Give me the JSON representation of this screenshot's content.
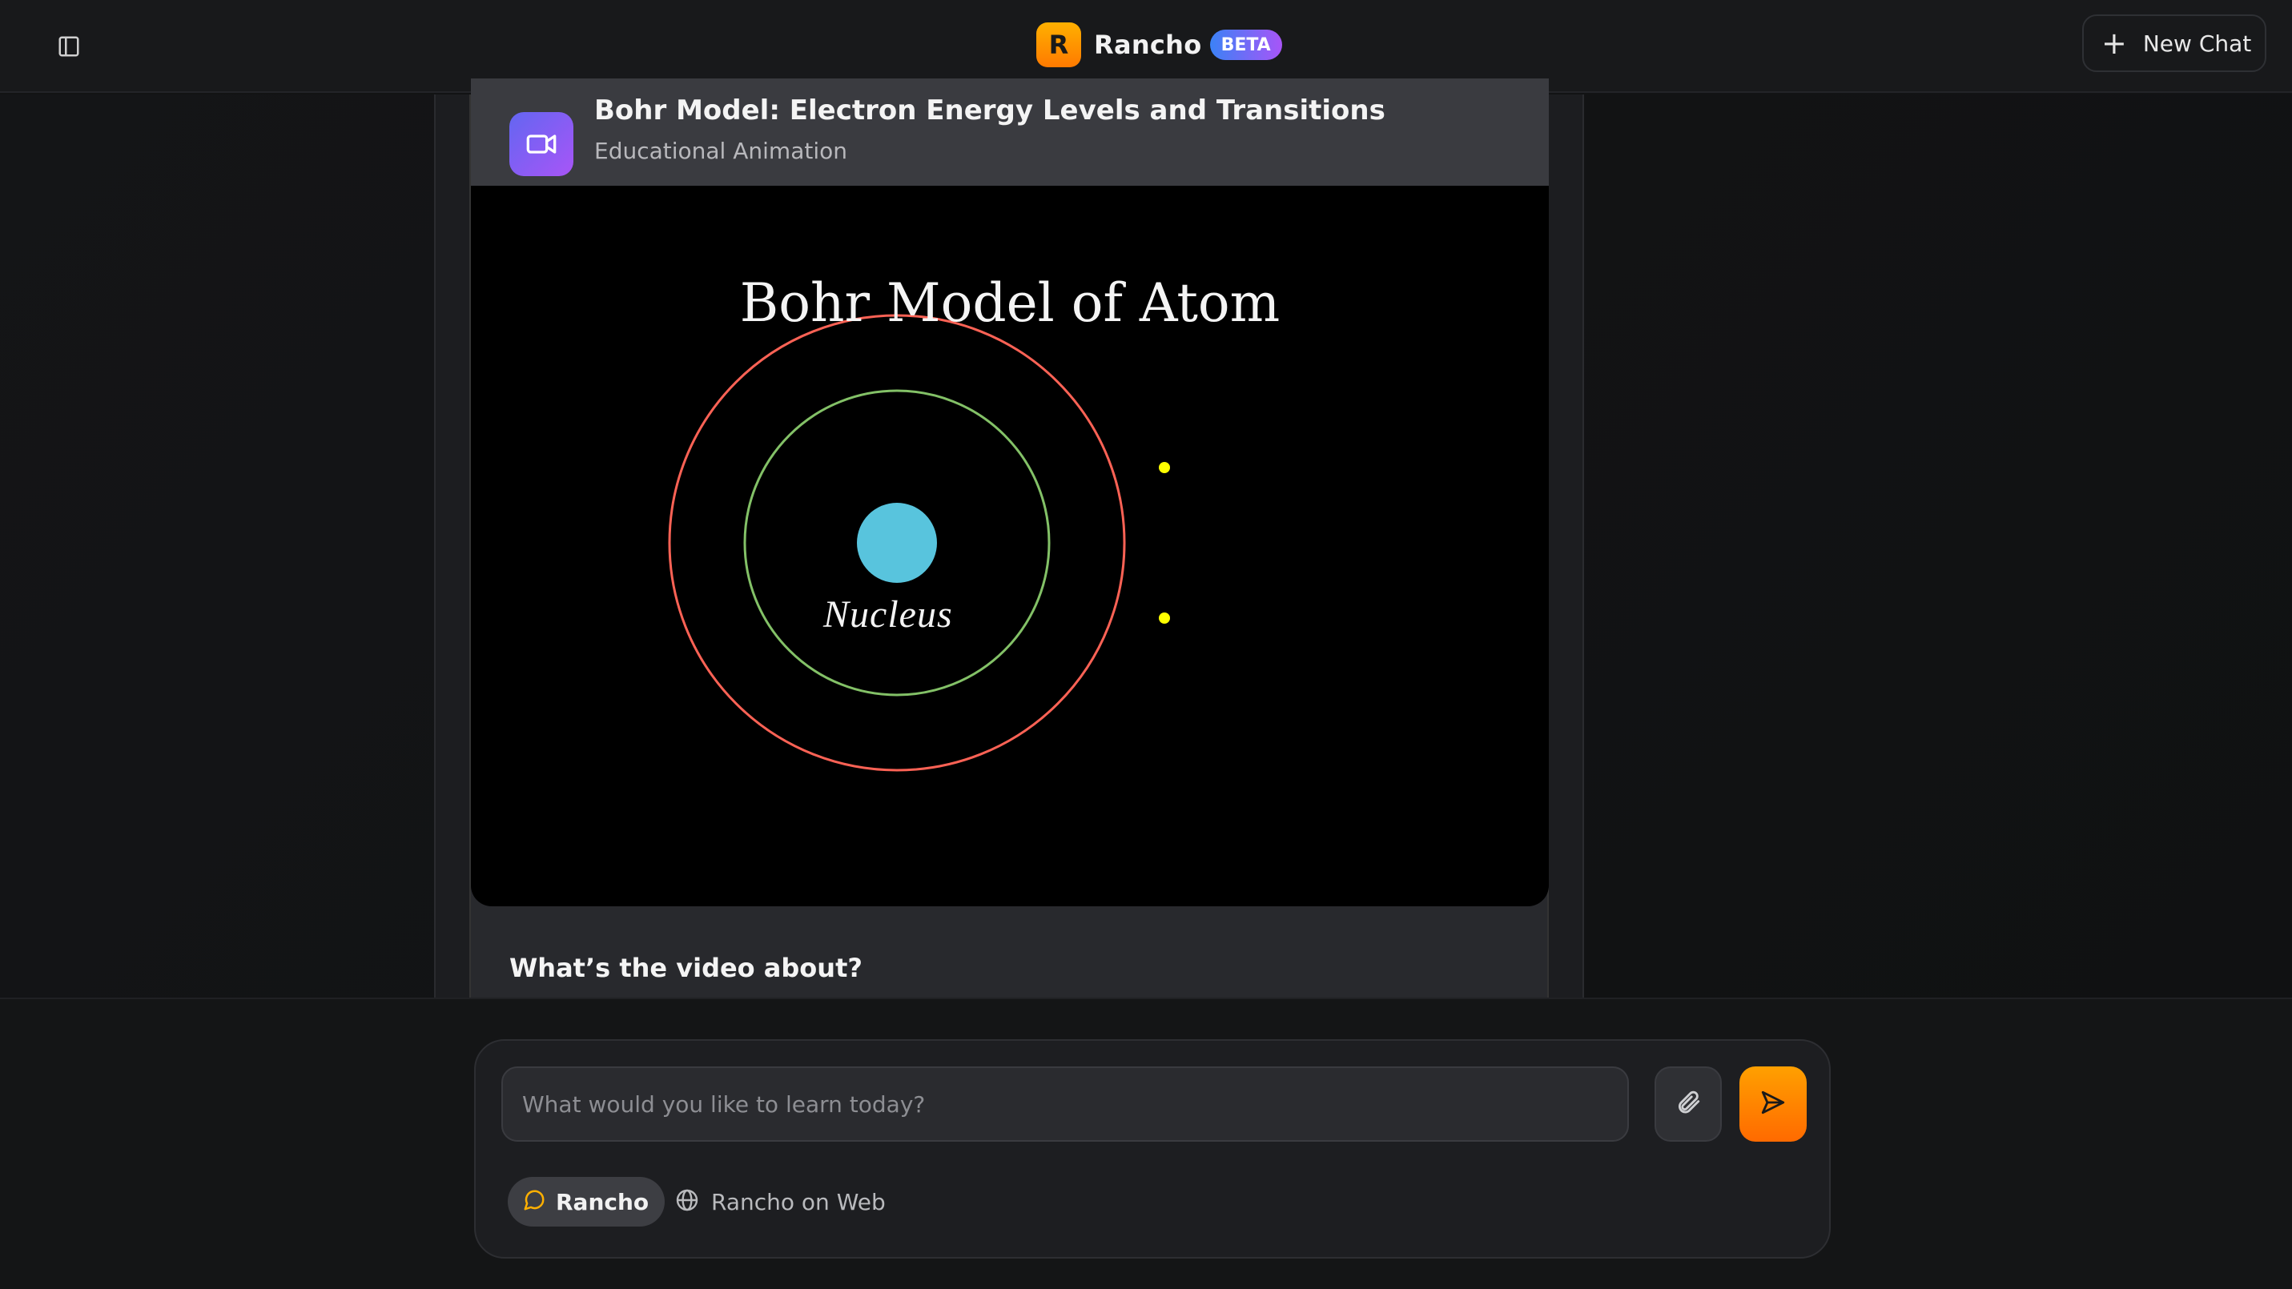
{
  "header": {
    "logo_letter": "R",
    "app_name": "Rancho",
    "badge": "BETA",
    "new_chat_label": "New Chat"
  },
  "card": {
    "title": "Bohr Model: Electron Energy Levels and Transitions",
    "subtitle": "Educational Animation",
    "icon": "video-camera-icon"
  },
  "video": {
    "title": "Bohr Model of Atom",
    "nucleus_label": "Nucleus",
    "colors": {
      "inner_orbit": "#83c167",
      "outer_orbit": "#fc6255",
      "nucleus": "#58c4dd",
      "electron": "#ffff00"
    }
  },
  "section": {
    "question": "What’s the video about?"
  },
  "composer": {
    "placeholder": "What would you like to learn today?",
    "modes": [
      {
        "label": "Rancho",
        "icon": "chat-bubble-icon",
        "selected": true
      },
      {
        "label": "Rancho on Web",
        "icon": "globe-icon",
        "selected": false
      }
    ]
  },
  "colors": {
    "accent": "#ff8a00",
    "badge_gradient_start": "#3b82f6",
    "badge_gradient_end": "#a855f7"
  }
}
